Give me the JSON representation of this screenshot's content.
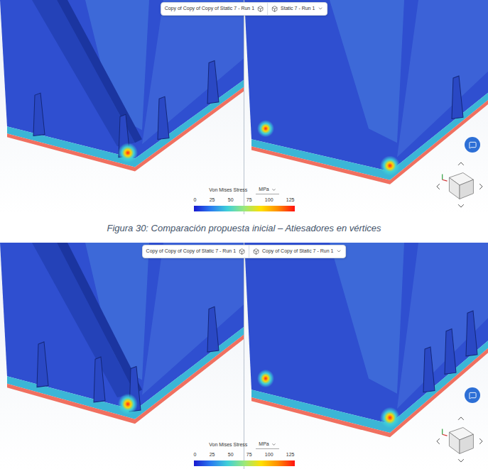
{
  "figures": [
    {
      "compare_bar": {
        "left": "Copy of Copy of Copy of Static 7 - Run 1",
        "right": "Static 7 - Run 1"
      },
      "legend": {
        "title": "Von Mises Stress",
        "unit": "MPa",
        "ticks": [
          "0",
          "25",
          "50",
          "75",
          "100",
          "125"
        ]
      },
      "caption": "Figura 30: Comparación propuesta inicial – Atiesadores en vértices"
    },
    {
      "compare_bar": {
        "left": "Copy of Copy of Copy of Static 7 - Run 1",
        "right": "Copy of Copy of Static 7 - Run 1"
      },
      "legend": {
        "title": "Von Mises Stress",
        "unit": "MPa",
        "ticks": [
          "0",
          "25",
          "50",
          "75",
          "100",
          "125"
        ]
      },
      "caption": ""
    }
  ]
}
